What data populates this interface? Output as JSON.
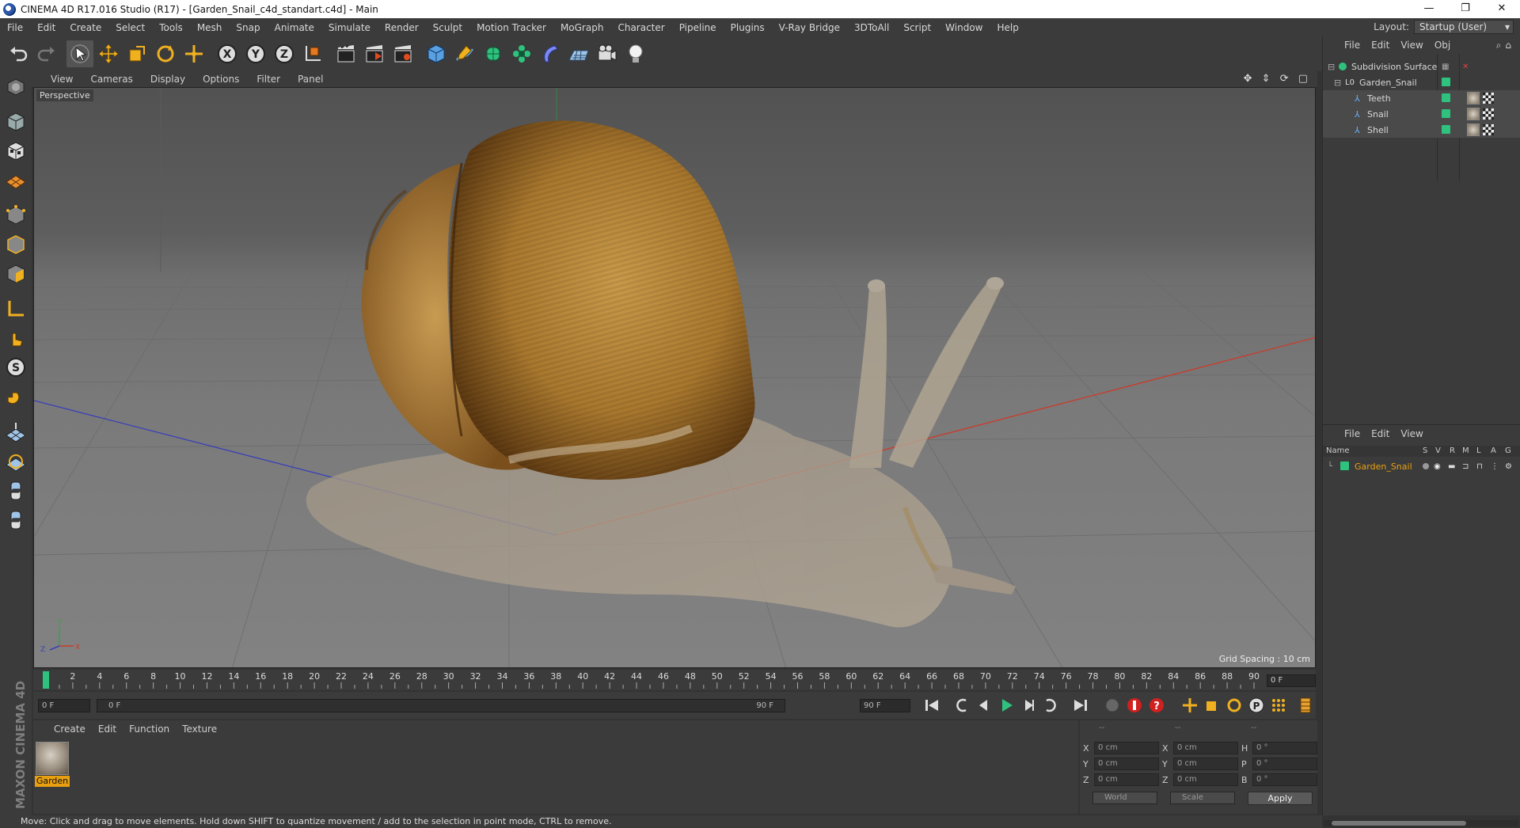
{
  "window": {
    "title": "CINEMA 4D R17.016 Studio (R17) - [Garden_Snail_c4d_standart.c4d] - Main",
    "controls": [
      "—",
      "❐",
      "✕"
    ]
  },
  "menubar": {
    "items": [
      "File",
      "Edit",
      "Create",
      "Select",
      "Tools",
      "Mesh",
      "Snap",
      "Animate",
      "Simulate",
      "Render",
      "Sculpt",
      "Motion Tracker",
      "MoGraph",
      "Character",
      "Pipeline",
      "Plugins",
      "V-Ray Bridge",
      "3DToAll",
      "Script",
      "Window",
      "Help"
    ],
    "layout_label": "Layout:",
    "layout_value": "Startup (User)"
  },
  "viewport": {
    "menu": [
      "View",
      "Cameras",
      "Display",
      "Options",
      "Filter",
      "Panel"
    ],
    "camera_label": "Perspective",
    "grid_spacing": "Grid Spacing : 10 cm",
    "nav_icons": "✥ ⇕ ⟳ ▢"
  },
  "timeline": {
    "ticks": [
      "0",
      "2",
      "4",
      "6",
      "8",
      "10",
      "12",
      "14",
      "16",
      "18",
      "20",
      "22",
      "24",
      "26",
      "28",
      "30",
      "32",
      "34",
      "36",
      "38",
      "40",
      "42",
      "44",
      "46",
      "48",
      "50",
      "52",
      "54",
      "56",
      "58",
      "60",
      "62",
      "64",
      "66",
      "68",
      "70",
      "72",
      "74",
      "76",
      "78",
      "80",
      "82",
      "84",
      "86",
      "88",
      "90"
    ],
    "current_frame_field": "0 F",
    "end_field": "0 F"
  },
  "transport": {
    "start_field": "0 F",
    "range_start": "0 F",
    "range_end": "90 F",
    "end_field": "90 F"
  },
  "material_manager": {
    "menu": [
      "Create",
      "Edit",
      "Function",
      "Texture"
    ],
    "materials": [
      {
        "name": "Garden"
      }
    ]
  },
  "coordinates": {
    "header": [
      "--",
      "--",
      "--"
    ],
    "rows": [
      {
        "l1": "X",
        "v1": "0 cm",
        "l2": "X",
        "v2": "0 cm",
        "l3": "H",
        "v3": "0 °"
      },
      {
        "l1": "Y",
        "v1": "0 cm",
        "l2": "Y",
        "v2": "0 cm",
        "l3": "P",
        "v3": "0 °"
      },
      {
        "l1": "Z",
        "v1": "0 cm",
        "l2": "Z",
        "v2": "0 cm",
        "l3": "B",
        "v3": "0 °"
      }
    ],
    "mode_world": "World",
    "mode_scale": "Scale",
    "apply_label": "Apply"
  },
  "object_manager": {
    "menu": [
      "File",
      "Edit",
      "View",
      "Obj"
    ],
    "objects": [
      {
        "name": "Subdivision Surface",
        "depth": 0
      },
      {
        "name": "Garden_Snail",
        "depth": 1
      },
      {
        "name": "Teeth",
        "depth": 2
      },
      {
        "name": "Snail",
        "depth": 2
      },
      {
        "name": "Shell",
        "depth": 2
      }
    ]
  },
  "layer_manager": {
    "menu": [
      "File",
      "Edit",
      "View"
    ],
    "columns": [
      "Name",
      "S",
      "V",
      "R",
      "M",
      "L",
      "A",
      "G"
    ],
    "layers": [
      {
        "name": "Garden_Snail",
        "color": "#2ec27e"
      }
    ]
  },
  "branding": "MAXON CINEMA 4D",
  "status": "Move: Click and drag to move elements. Hold down SHIFT to quantize movement / add to the selection in point mode, CTRL to remove.",
  "colors": {
    "accent": "#e9a010",
    "layer_green": "#2ec27e",
    "axis_x": "#d04030",
    "axis_z": "#3040c0"
  }
}
